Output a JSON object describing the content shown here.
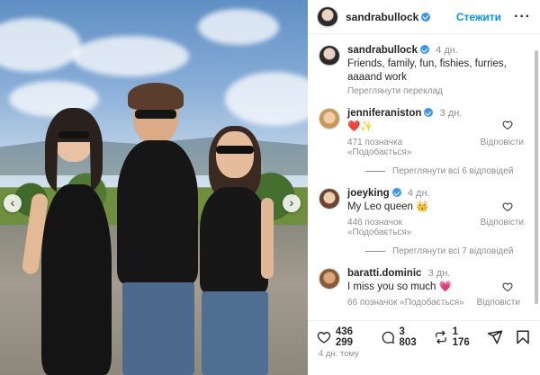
{
  "post": {
    "author": "sandrabullock",
    "follow_label": "Стежити",
    "more_icon": "more-horizontal-icon",
    "caption_time": "4 дн.",
    "caption": "Friends, family, fun, fishies, furries, aaaand work",
    "translate_label": "Переглянути переклад",
    "date": "4 дн. тому"
  },
  "comments": [
    {
      "username": "jenniferaniston",
      "time": "3 дн.",
      "text": "❤️✨",
      "likes": "471 позначка «Подобається»",
      "reply_label": "Відповісти",
      "replies_label": "Переглянути всі 6 відповідей"
    },
    {
      "username": "joeyking",
      "time": "4 дн.",
      "text": "My Leo queen 👑",
      "likes": "446 позначок «Подобається»",
      "reply_label": "Відповісти",
      "replies_label": "Переглянути всі 7 відповідей"
    },
    {
      "username": "baratti.dominic",
      "time": "3 дн.",
      "text": "I miss you so much 💗",
      "likes": "66 позначок «Подобається»",
      "reply_label": "Відповісти"
    }
  ],
  "actions": {
    "likes": "436 299",
    "comments": "3 803",
    "reposts": "1 176"
  },
  "colors": {
    "accent": "#0095f6",
    "verified": "#3897f0",
    "muted": "#8e8e8e",
    "text": "#262626"
  }
}
